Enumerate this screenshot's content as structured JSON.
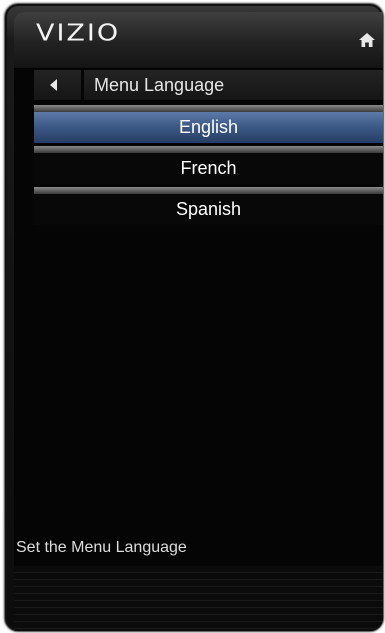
{
  "header": {
    "brand": "VIZIO",
    "home_icon": "home-icon"
  },
  "menu": {
    "title": "Menu Language",
    "back_icon": "back-arrow-icon",
    "options": [
      {
        "label": "English",
        "selected": true
      },
      {
        "label": "French",
        "selected": false
      },
      {
        "label": "Spanish",
        "selected": false
      }
    ]
  },
  "footer": {
    "description": "Set the Menu Language"
  },
  "colors": {
    "selected_highlight": "#3e5a87",
    "background": "#050505",
    "text": "#ffffff"
  }
}
